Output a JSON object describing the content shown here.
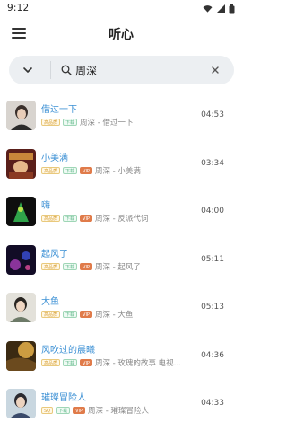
{
  "status_bar": {
    "time": "9:12",
    "icons": [
      "wifi-icon",
      "signal-icon",
      "battery-icon"
    ]
  },
  "app_bar": {
    "title": "听心",
    "menu_icon": "menu-icon"
  },
  "search": {
    "query": "周深",
    "dropdown_icon": "chevron-down-icon",
    "search_icon": "search-icon",
    "clear_icon": "close-icon"
  },
  "colors": {
    "accent": "#3a8fd4",
    "search_bg": "#eceff2",
    "tag_vip": "#e07b4a",
    "tag_quality": "#d9a23c",
    "tag_download": "#5fb88a"
  },
  "songs": [
    {
      "title": "借过一下",
      "tags": [
        "高品质",
        "下载"
      ],
      "subtitle": "周深 - 借过一下",
      "duration": "04:53",
      "cover": "cover-dark-portrait"
    },
    {
      "title": "小美满",
      "tags": [
        "高品质",
        "下载",
        "VIP"
      ],
      "subtitle": "周深 - 小美满",
      "duration": "03:34",
      "cover": "cover-warm-red"
    },
    {
      "title": "嗨",
      "tags": [
        "高品质",
        "下载",
        "VIP"
      ],
      "subtitle": "周深 - 反派代词",
      "duration": "04:00",
      "cover": "cover-green-black"
    },
    {
      "title": "起风了",
      "tags": [
        "高品质",
        "下载",
        "VIP"
      ],
      "subtitle": "周深 - 起风了",
      "duration": "05:11",
      "cover": "cover-night-purple"
    },
    {
      "title": "大鱼",
      "tags": [
        "高品质",
        "下载",
        "VIP"
      ],
      "subtitle": "周深 - 大鱼",
      "duration": "05:13",
      "cover": "cover-pale-portrait"
    },
    {
      "title": "风吹过的晨曦",
      "tags": [
        "高品质",
        "下载",
        "VIP"
      ],
      "subtitle": "周深 - 玫瑰的故事 电视...",
      "duration": "04:36",
      "cover": "cover-golden"
    },
    {
      "title": "璀璨冒险人",
      "tags": [
        "SQ",
        "下载",
        "VIP"
      ],
      "subtitle": "周深 - 璀璨冒险人",
      "duration": "04:33",
      "cover": "cover-blue-portrait"
    }
  ]
}
